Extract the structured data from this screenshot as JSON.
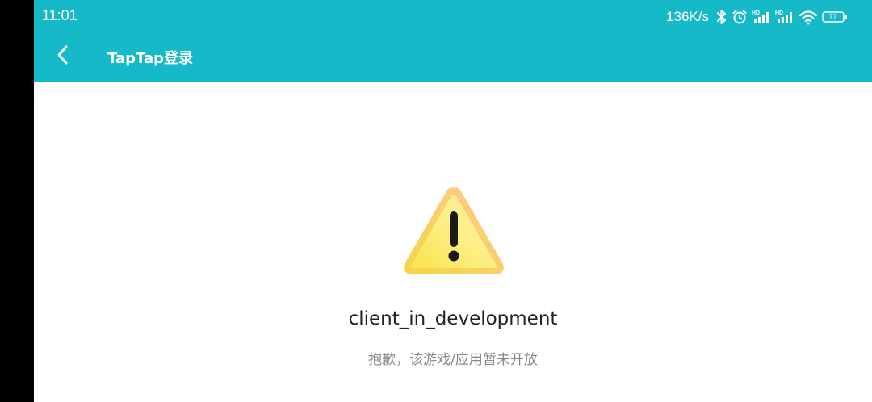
{
  "status_bar": {
    "time": "11:01",
    "net_speed": "136K/s",
    "battery_level": "77",
    "icons": [
      "bluetooth-icon",
      "alarm-icon",
      "signal-hd-icon",
      "signal-hd-icon",
      "wifi-icon",
      "battery-icon"
    ]
  },
  "toolbar": {
    "title": "TapTap登录",
    "back_icon": "chevron-left-icon",
    "background_color": "#16b9c8"
  },
  "content": {
    "icon": "warning-icon",
    "message": "client_in_development",
    "sub_message": "抱歉，该游戏/应用暂未开放"
  }
}
